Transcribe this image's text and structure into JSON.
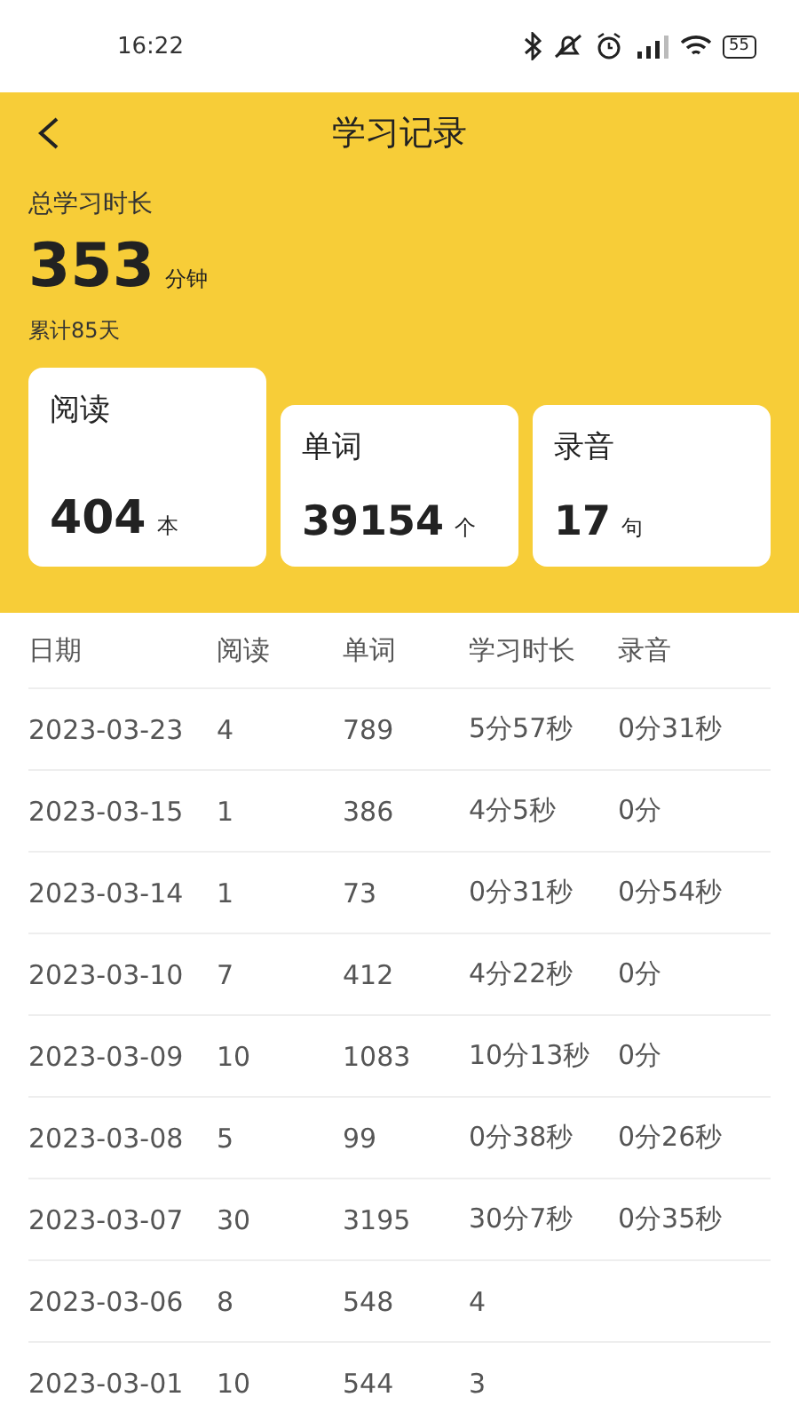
{
  "status_bar": {
    "time": "16:22",
    "battery": "55"
  },
  "header": {
    "title": "学习记录"
  },
  "summary": {
    "label": "总学习时长",
    "value": "353",
    "unit": "分钟",
    "days": "累计85天"
  },
  "cards": [
    {
      "label": "阅读",
      "value": "404",
      "unit": "本",
      "selected": true
    },
    {
      "label": "单词",
      "value": "39154",
      "unit": "个",
      "selected": false
    },
    {
      "label": "录音",
      "value": "17",
      "unit": "句",
      "selected": false
    }
  ],
  "table": {
    "columns": [
      "日期",
      "阅读",
      "单词",
      "学习时长",
      "录音"
    ],
    "rows": [
      [
        "2023-03-23",
        "4",
        "789",
        "5分57秒",
        "0分31秒"
      ],
      [
        "2023-03-15",
        "1",
        "386",
        "4分5秒",
        "0分"
      ],
      [
        "2023-03-14",
        "1",
        "73",
        "0分31秒",
        "0分54秒"
      ],
      [
        "2023-03-10",
        "7",
        "412",
        "4分22秒",
        "0分"
      ],
      [
        "2023-03-09",
        "10",
        "1083",
        "10分13秒",
        "0分"
      ],
      [
        "2023-03-08",
        "5",
        "99",
        "0分38秒",
        "0分26秒"
      ],
      [
        "2023-03-07",
        "30",
        "3195",
        "30分7秒",
        "0分35秒"
      ],
      [
        "2023-03-06",
        "8",
        "548",
        "4"
      ],
      [
        "2023-03-01",
        "10",
        "544",
        "3"
      ]
    ]
  }
}
